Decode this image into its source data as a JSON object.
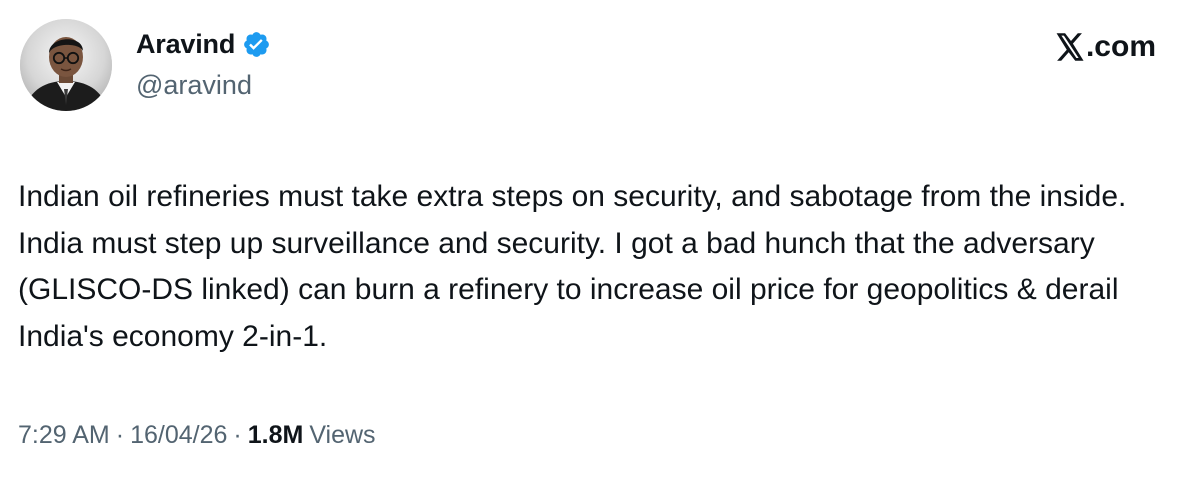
{
  "author": {
    "display_name": "Aravind",
    "handle": "@aravind",
    "verified_icon": "verified-badge-icon",
    "avatar_icon": "avatar-portrait"
  },
  "brand": {
    "logo_icon": "x-logo-icon",
    "text": ".com"
  },
  "tweet": {
    "text": "Indian oil refineries must take extra steps on security, and sabotage from the inside. India must step up surveillance and security. I got a bad hunch that the adversary (GLISCO-DS linked) can burn a refinery to increase oil price for geopolitics & derail India's economy 2-in-1."
  },
  "meta": {
    "time": "7:29 AM",
    "separator": "·",
    "date": "16/04/26",
    "views_count": "1.8M",
    "views_label": "Views"
  },
  "colors": {
    "text_primary": "#0f1419",
    "text_secondary": "#536471",
    "verified_blue": "#1d9bf0",
    "background": "#ffffff"
  }
}
